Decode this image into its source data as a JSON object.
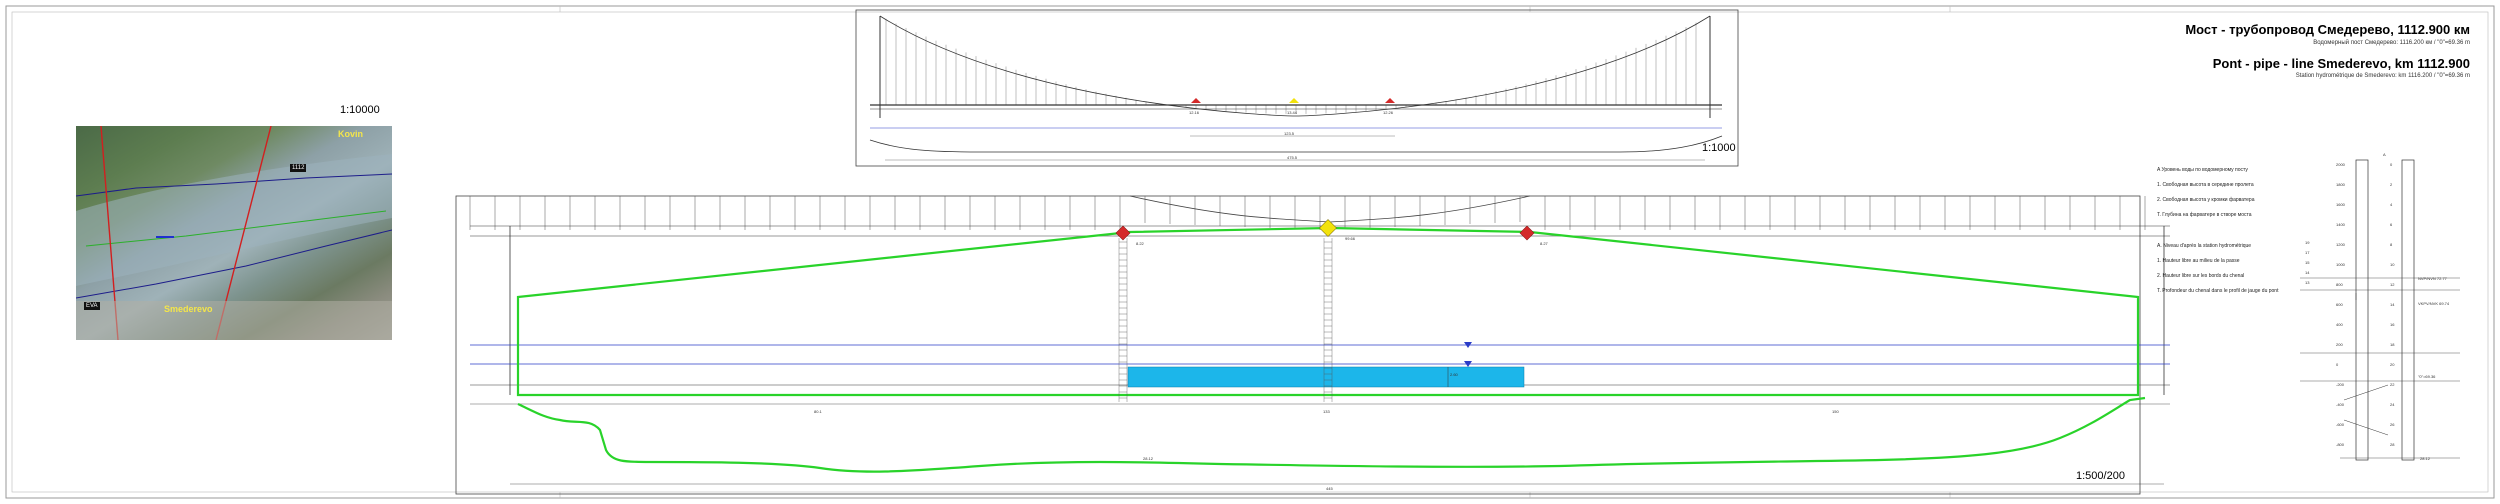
{
  "titles": {
    "ru_title": "Мост - трубопровод Смедерево, 1112.900 км",
    "ru_subtitle": "Водомерный пост Смедерево: 1116.200 км / \"0\"=69.36 m",
    "fr_title": "Pont - pipe - line Smederevo, km 1112.900",
    "fr_subtitle": "Station hydrométrique de Smederevo: km 1116.200 / \"0\"=69.36 m"
  },
  "scales": {
    "map": "1:10000",
    "elevation": "1:1000",
    "section": "1:500/200"
  },
  "map": {
    "labels": [
      "Kovin",
      "Smederevo"
    ],
    "tags": [
      "1112",
      "EVA"
    ]
  },
  "elevation_view": {
    "values": [
      "12.16",
      "13.44",
      "12.26"
    ],
    "span": "123.5",
    "total": "475.5"
  },
  "section_view": {
    "left_marker": "8.22",
    "mid_marker": "99.66",
    "right_marker": "8.27",
    "depth_label": "2.60",
    "bottom_label": "28.12",
    "total_length": "445",
    "dims": [
      "80.1",
      "133",
      "150"
    ]
  },
  "legend": {
    "ru": [
      "A Уровень воды по водомерному посту",
      "1. Свободная высота в середине пролета",
      "2. Свободная высота у кромки фарватера",
      "T. Глубина на фарватере в створе моста"
    ],
    "fr": [
      "A. Niveau d'après la station hydrométrique",
      "1. Hauteur libre au milieu de la passe",
      "2. Hauteur libre sur les bords du chenal",
      "T. Profondeur du chenal dans le profil de jauge du pont"
    ]
  },
  "gauge": {
    "top_label": "A",
    "left_ticks": [
      "2000",
      "1800",
      "1600",
      "1400",
      "1200",
      "1000",
      "800",
      "600",
      "400",
      "200",
      "0",
      "-200",
      "-400",
      "-600",
      "-800"
    ],
    "right_ticks": [
      "0",
      "2",
      "4",
      "6",
      "8",
      "10",
      "12",
      "14",
      "16",
      "18",
      "20",
      "22",
      "24",
      "26",
      "28"
    ],
    "row_labels": [
      "19",
      "17",
      "15",
      "14",
      "13"
    ],
    "level_labels": [
      "NVP/NVN 72.77",
      "VKPV/NVK 69.74",
      "\"0\"=69.36"
    ],
    "bottom_label": "28.12"
  },
  "colors": {
    "outline": "#29d32a",
    "water": "#1cb6ea",
    "marker_red": "#d42a2a",
    "marker_yellow": "#f2e20c",
    "blue_line": "#2a3cc8"
  }
}
